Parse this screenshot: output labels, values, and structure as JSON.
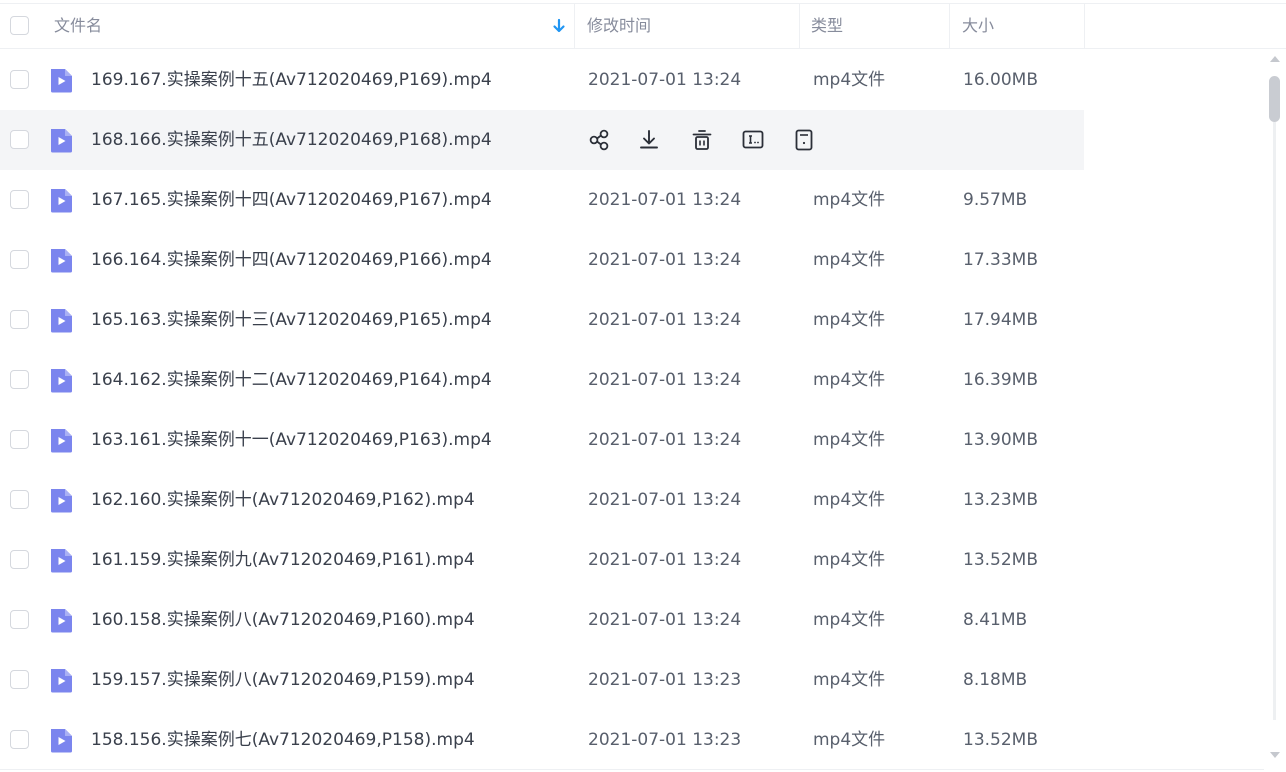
{
  "header": {
    "name_label": "文件名",
    "time_label": "修改时间",
    "type_label": "类型",
    "size_label": "大小"
  },
  "colors": {
    "accent": "#2196f3",
    "file_icon": "#7b85ee"
  },
  "row_actions": [
    "share-icon",
    "download-icon",
    "delete-icon",
    "rename-icon",
    "more-icon"
  ],
  "rows": [
    {
      "name": "169.167.实操案例十五(Av712020469,P169).mp4",
      "time": "2021-07-01 13:24",
      "type": "mp4文件",
      "size": "16.00MB"
    },
    {
      "name": "168.166.实操案例十五(Av712020469,P168).mp4",
      "time": "",
      "type": "",
      "size": ""
    },
    {
      "name": "167.165.实操案例十四(Av712020469,P167).mp4",
      "time": "2021-07-01 13:24",
      "type": "mp4文件",
      "size": "9.57MB"
    },
    {
      "name": "166.164.实操案例十四(Av712020469,P166).mp4",
      "time": "2021-07-01 13:24",
      "type": "mp4文件",
      "size": "17.33MB"
    },
    {
      "name": "165.163.实操案例十三(Av712020469,P165).mp4",
      "time": "2021-07-01 13:24",
      "type": "mp4文件",
      "size": "17.94MB"
    },
    {
      "name": "164.162.实操案例十二(Av712020469,P164).mp4",
      "time": "2021-07-01 13:24",
      "type": "mp4文件",
      "size": "16.39MB"
    },
    {
      "name": "163.161.实操案例十一(Av712020469,P163).mp4",
      "time": "2021-07-01 13:24",
      "type": "mp4文件",
      "size": "13.90MB"
    },
    {
      "name": "162.160.实操案例十(Av712020469,P162).mp4",
      "time": "2021-07-01 13:24",
      "type": "mp4文件",
      "size": "13.23MB"
    },
    {
      "name": "161.159.实操案例九(Av712020469,P161).mp4",
      "time": "2021-07-01 13:24",
      "type": "mp4文件",
      "size": "13.52MB"
    },
    {
      "name": "160.158.实操案例八(Av712020469,P160).mp4",
      "time": "2021-07-01 13:24",
      "type": "mp4文件",
      "size": "8.41MB"
    },
    {
      "name": "159.157.实操案例八(Av712020469,P159).mp4",
      "time": "2021-07-01 13:23",
      "type": "mp4文件",
      "size": "8.18MB"
    },
    {
      "name": "158.156.实操案例七(Av712020469,P158).mp4",
      "time": "2021-07-01 13:23",
      "type": "mp4文件",
      "size": "13.52MB"
    }
  ]
}
